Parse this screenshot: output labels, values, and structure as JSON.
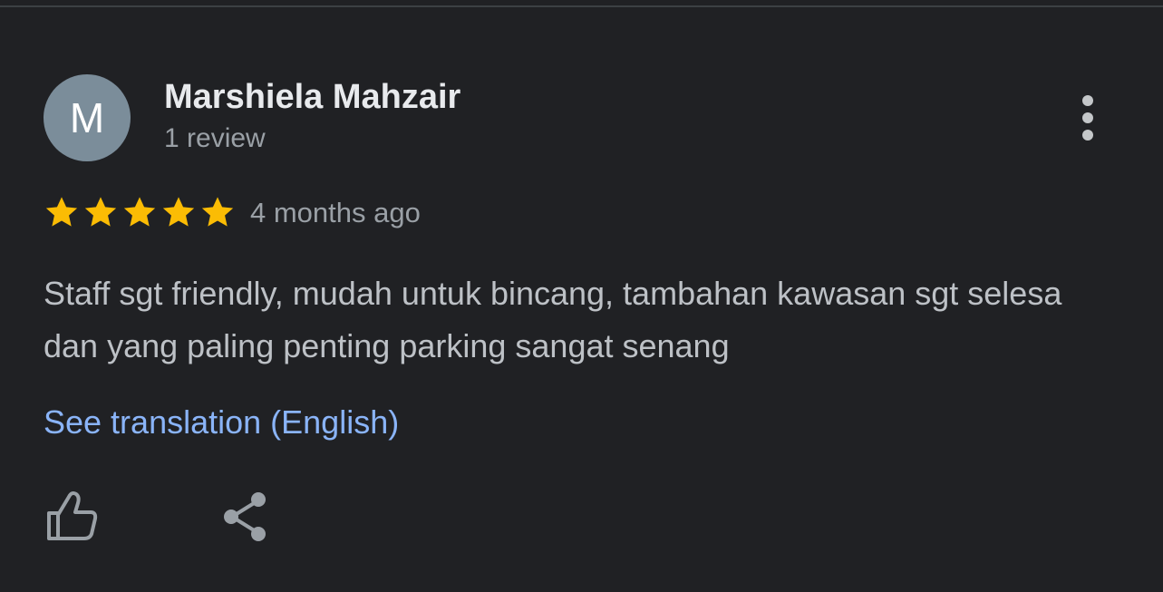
{
  "review": {
    "avatar_initial": "M",
    "author_name": "Marshiela Mahzair",
    "review_count": "1 review",
    "rating": 5,
    "rating_max": 5,
    "date": "4 months ago",
    "text": "Staff sgt friendly, mudah untuk bincang, tambahan kawasan sgt selesa dan yang paling penting parking sangat senang",
    "translate_label": "See translation (English)"
  },
  "actions": {
    "more_icon": "more-vert-icon",
    "like_icon": "thumb-up-icon",
    "share_icon": "share-icon"
  },
  "colors": {
    "background": "#202124",
    "star": "#fbbc04",
    "link": "#8ab4f8",
    "avatar": "#7b8d9a"
  }
}
